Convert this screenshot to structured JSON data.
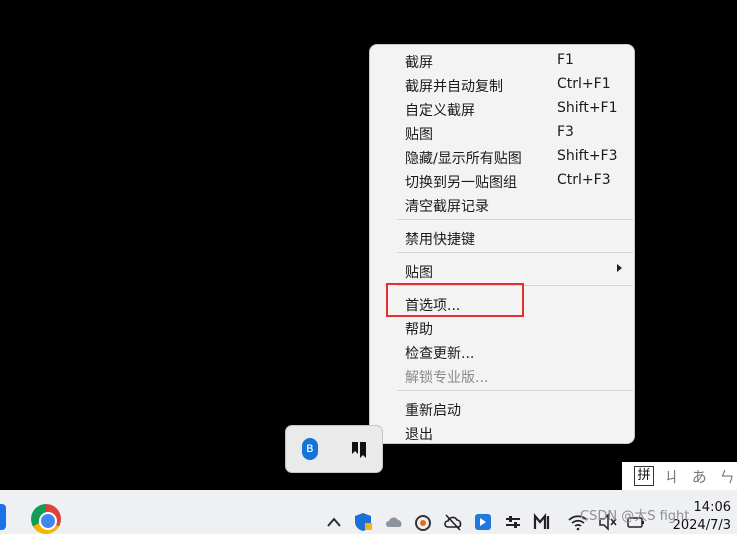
{
  "menu": {
    "items": [
      {
        "label": "截屏",
        "shortcut": "F1"
      },
      {
        "label": "截屏并自动复制",
        "shortcut": "Ctrl+F1"
      },
      {
        "label": "自定义截屏",
        "shortcut": "Shift+F1"
      },
      {
        "label": "贴图",
        "shortcut": "F3"
      },
      {
        "label": "隐藏/显示所有贴图",
        "shortcut": "Shift+F3"
      },
      {
        "label": "切换到另一贴图组",
        "shortcut": "Ctrl+F3"
      },
      {
        "label": "清空截屏记录",
        "shortcut": ""
      },
      {
        "label": "禁用快捷键",
        "shortcut": ""
      },
      {
        "label": "贴图",
        "shortcut": ""
      },
      {
        "label": "首选项...",
        "shortcut": ""
      },
      {
        "label": "帮助",
        "shortcut": ""
      },
      {
        "label": "检查更新...",
        "shortcut": ""
      },
      {
        "label": "解锁专业版...",
        "shortcut": ""
      },
      {
        "label": "重新启动",
        "shortcut": ""
      },
      {
        "label": "退出",
        "shortcut": ""
      }
    ]
  },
  "ime": {
    "mode": "拼",
    "tail": "ㄐ あ ㄣ"
  },
  "taskbar": {
    "time": "14:06",
    "date": "2024/7/3",
    "watermark": "CSDN @大S fight"
  },
  "flyout": {
    "bluetooth_glyph": "ʙ"
  },
  "colors": {
    "highlight": "#e5312b",
    "menu_bg": "#f3f3f3"
  }
}
